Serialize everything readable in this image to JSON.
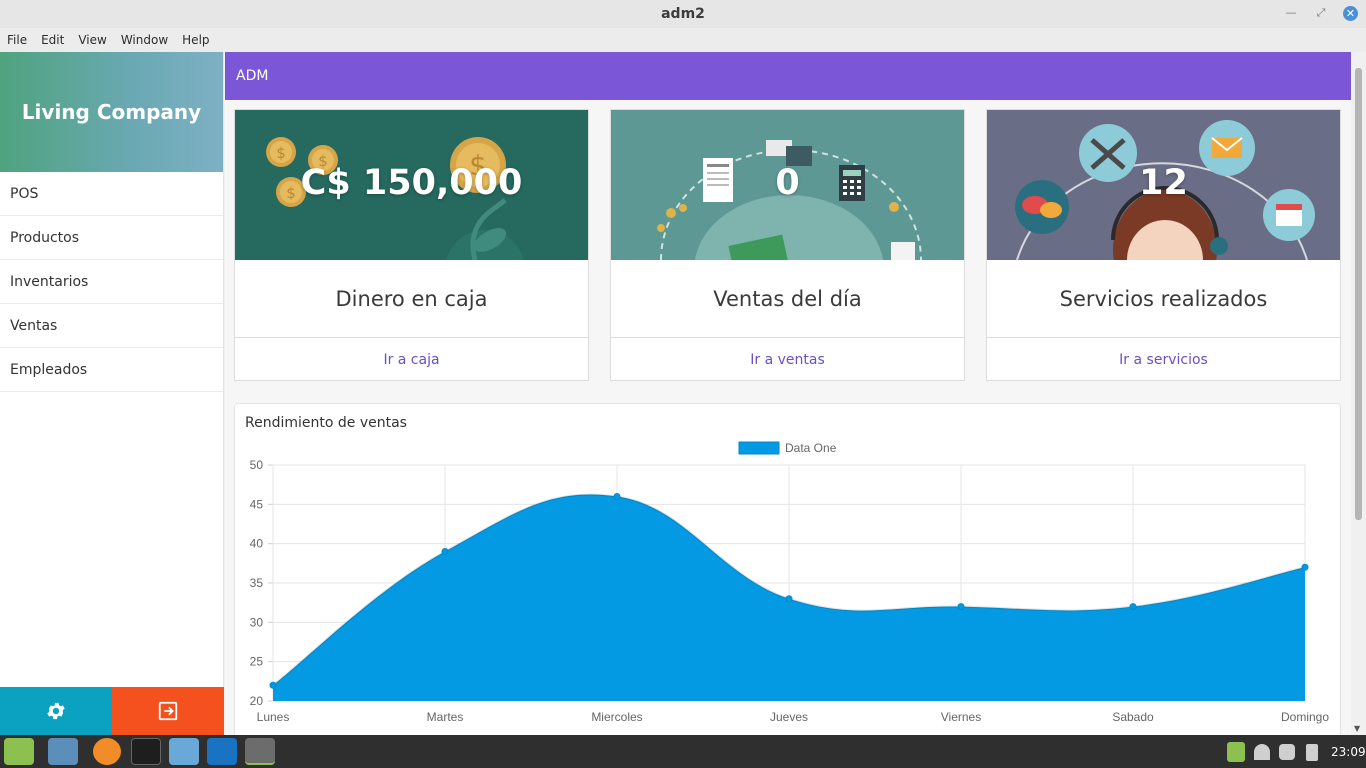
{
  "window": {
    "title": "adm2"
  },
  "menu": [
    "File",
    "Edit",
    "View",
    "Window",
    "Help"
  ],
  "sidebar": {
    "brand": "Living Company",
    "items": [
      {
        "label": "POS"
      },
      {
        "label": "Productos"
      },
      {
        "label": "Inventarios"
      },
      {
        "label": "Ventas"
      },
      {
        "label": "Empleados"
      }
    ],
    "settings_icon": "gear-icon",
    "logout_icon": "logout-icon",
    "settings_color": "#0aa2c0",
    "logout_color": "#f4511e"
  },
  "topbar": {
    "title": "ADM",
    "color": "#7b56d6"
  },
  "cards": [
    {
      "value": "C$ 150,000",
      "title": "Dinero en caja",
      "link": "Ir a caja",
      "bg": "#26695f"
    },
    {
      "value": "0",
      "title": "Ventas del día",
      "link": "Ir a ventas",
      "bg": "#5e9894"
    },
    {
      "value": "12",
      "title": "Servicios realizados",
      "link": "Ir a servicios",
      "bg": "#6a6d86"
    }
  ],
  "chart": {
    "title": "Rendimiento de ventas"
  },
  "chart_data": {
    "type": "area",
    "categories": [
      "Lunes",
      "Martes",
      "Miercoles",
      "Jueves",
      "Viernes",
      "Sabado",
      "Domingo"
    ],
    "series": [
      {
        "name": "Data One",
        "values": [
          22,
          39,
          46,
          33,
          32,
          32,
          37
        ],
        "color": "#0399e3"
      }
    ],
    "ylim": [
      20,
      50
    ],
    "yticks": [
      20,
      25,
      30,
      35,
      40,
      45,
      50
    ],
    "grid": true,
    "legend": "top-center"
  },
  "taskbar": {
    "time": "23:09"
  }
}
